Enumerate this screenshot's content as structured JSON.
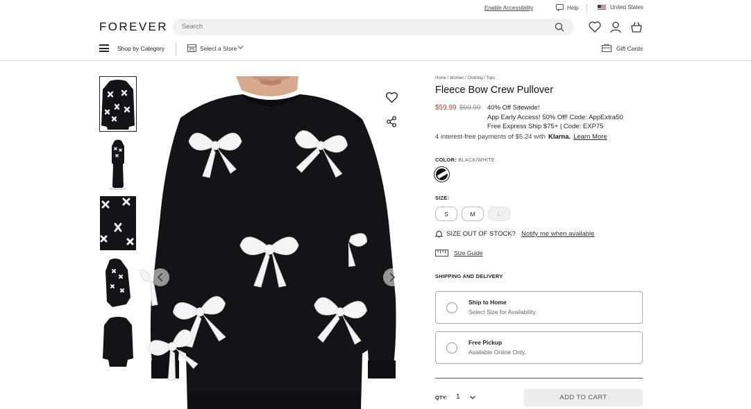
{
  "utility": {
    "accessibility_label": "Enable Accessibility",
    "help_label": "Help",
    "country_label": "United States"
  },
  "header": {
    "logo": "FOREVER 21",
    "search_placeholder": "Search",
    "icons": [
      "heart-icon",
      "user-icon",
      "bag-icon"
    ]
  },
  "nav": {
    "category_label": "Shop by Category",
    "store_label": "Select a Store",
    "gift_label": "Gift Cards"
  },
  "product": {
    "breadcrumb": "Home / Women / Clothing / Tops",
    "title": "Fleece Bow Crew Pullover",
    "price_sale": "$59.99",
    "price_original": "$99.99",
    "promos": [
      "40% Off Sitewide!",
      "App Early Access! 50% Off! Code: AppExtra50",
      "Free Express Ship $75+ | Code: EXP75"
    ],
    "installments_text": "4 interest-free payments of $5.24 with",
    "klarna": "Klarna.",
    "learn_more": "Learn More",
    "color_label": "COLOR:",
    "color_value": "BLACK/WHITE",
    "size_label": "SIZE:",
    "sizes": [
      {
        "label": "S",
        "available": true
      },
      {
        "label": "M",
        "available": true
      },
      {
        "label": "L",
        "available": false
      }
    ],
    "oos_prompt": "SIZE OUT OF STOCK?",
    "notify_label": "Notify me when available",
    "size_guide_label": "Size Guide",
    "shipping_heading": "SHIPPING AND DELIVERY",
    "shipping_options": [
      {
        "title": "Ship to Home",
        "subtitle": "Select Size for Availability"
      },
      {
        "title": "Free Pickup",
        "subtitle": "Available Online Only."
      }
    ],
    "qty_label": "QTY:",
    "qty_value": "1",
    "add_to_cart_label": "ADD TO CART"
  },
  "colors": {
    "sale_price": "#c0392b",
    "garment": "#141418",
    "bow": "#f4f4f4"
  }
}
